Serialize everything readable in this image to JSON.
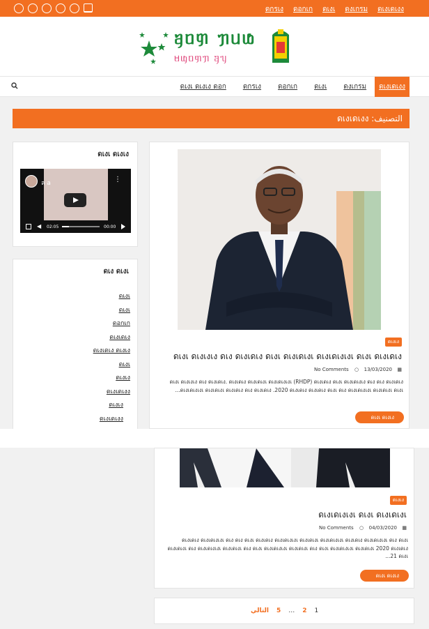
{
  "topbar": {
    "nav": [
      "ดกรเง",
      "ดอกเก",
      "ดเงเ",
      "ดงเกรม",
      "ดเงเดเงง"
    ]
  },
  "header": {
    "logo_title": "ᥠᥝᥞ ᥟᥙᥚ",
    "logo_sub": "ᥛᥜᥝᥞᥟ ᥠᥡ"
  },
  "nav": {
    "items": [
      "ดเงเดเงง",
      "ดงเกรม",
      "ดเงเ",
      "ดอกเก",
      "ดกรเง",
      "ดเงเ ดเงเง ดอก"
    ]
  },
  "category_banner": "التصنيف: ดเงเดเงง",
  "sidebar": {
    "video_title": "ดเงเ ดเงเง",
    "video_label": "ล a",
    "video_time_current": "02:05",
    "video_time_total": "00:00",
    "categories_title": "ดเง ดเงเ",
    "categories": [
      "ดเงเ",
      "ดเงเ",
      "ดอกเก",
      "ดเงเดเง",
      "ดเงเดเง ดเงเง",
      "ดเงเ",
      "ดเงเง",
      "ดเงเดเงง",
      "ดเงเง",
      "ดเงเดเงง"
    ]
  },
  "posts": [
    {
      "tag": "ดเงเง",
      "title": "ดเงเ ดเงเงเง ดเง ดเงเดเง ดเงเ ดเงเดเงเ ดเงเดเงเงเ ดเงเ ดเงเดเง",
      "comments": "No Comments",
      "date": "13/03/2020",
      "excerpt": "ดเงเ ดเงเงเง ดเง ดเงเดเง. ดเงเดเง ดเงเดเงเ ดเงเดเงเงเ (RHDP) ดเงเดเง ดเงเ ดเงเดเงเง ดเง ดเง ดเงเดเง ดเงเดเงเงเ ดเงเดเงเ ดเงเดเง ดเง ดเงเดเง .2020 ดเงเดเง ดเงเดเง ดเงเ ดเง ดเงเดเงเงเ ดเงเดเงเ ดเงเ...",
      "read_more": "ดเงเ ดเงเง"
    },
    {
      "tag": "ดเงเง",
      "title": "ดเงเดเงเงเ ดเงเ ดเงเดเงเ",
      "comments": "No Comments",
      "date": "04/03/2020",
      "excerpt": "ดเงเดเง ดเงเดเงเงเ ดเง ดเง ดเงเ ดเงเดเง ดเงเดเงเงเ ดเงเดเงเ ดเงเดเงเงเ ดเงเดเง ดเงเดเงเงเ ดเง ดเงเ ดเงเดเงเ ดเง ดเงเดเงเงเ ดเงเดเงเ ดเง ดเงเ ดเงเดเงเงเ ดเงเดเงเ ดเง ดเงเ ดเงเดเงเงเ ดเงเดเงเ 2020 ดเงเดเง 21 ดเงเ...",
      "read_more": "ดเงเ ดเงเง"
    }
  ],
  "pagination": {
    "current": "1",
    "pages": [
      "2",
      "…",
      "5"
    ],
    "next": "التالي"
  },
  "colors": {
    "accent": "#f26f21",
    "logo_green": "#1d8a3a",
    "logo_pink": "#e0497d"
  }
}
